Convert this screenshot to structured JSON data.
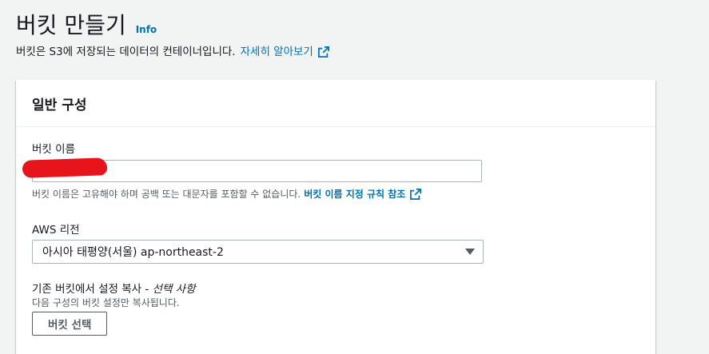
{
  "header": {
    "title": "버킷 만들기",
    "info_label": "Info",
    "description": "버킷은 S3에 저장되는 데이터의 컨테이너입니다.",
    "learn_more_label": "자세히 알아보기"
  },
  "general_config": {
    "section_title": "일반 구성",
    "bucket_name": {
      "label": "버킷 이름",
      "value": "",
      "hint": "버킷 이름은 고유해야 하며 공백 또는 대문자를 포함할 수 없습니다.",
      "hint_link": "버킷 이름 지정 규칙 참조"
    },
    "region": {
      "label": "AWS 리전",
      "selected": "아시아 태평양(서울) ap-northeast-2"
    },
    "copy_settings": {
      "label": "기존 버킷에서 설정 복사 -",
      "optional_label": "선택 사항",
      "description": "다음 구성의 버킷 설정만 복사됩니다.",
      "button_label": "버킷 선택"
    }
  },
  "colors": {
    "link": "#0073bb",
    "redaction": "#e8141b"
  },
  "icons": {
    "external_link": "external-link-icon",
    "dropdown": "caret-down-icon"
  }
}
